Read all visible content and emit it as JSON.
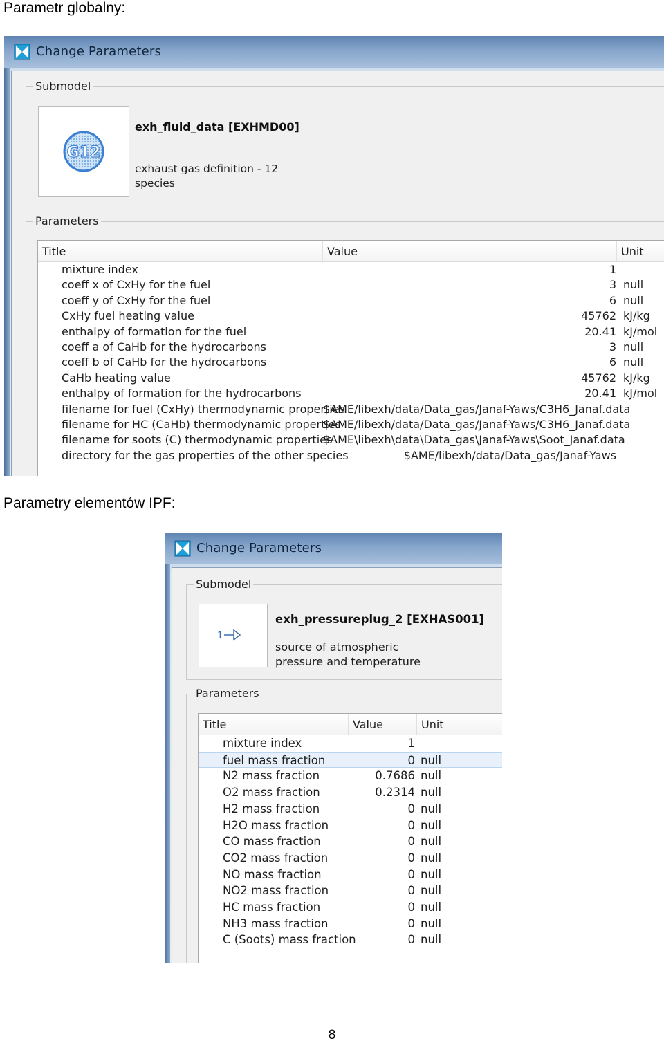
{
  "document": {
    "caption_global": "Parametr globalny:",
    "caption_ipf": "Parametry elementów IPF:",
    "page_number": "8"
  },
  "dialog_global": {
    "title": "Change Parameters",
    "submodel_label": "Submodel",
    "submodel_icon": "G12-globe-icon",
    "submodel_icon_text": "G12",
    "submodel_name": "exh_fluid_data [EXHMD00]",
    "submodel_desc_1": "exhaust gas definition - 12",
    "submodel_desc_2": "species",
    "parameters_label": "Parameters",
    "columns": {
      "title": "Title",
      "value": "Value",
      "unit": "Unit"
    },
    "rows": [
      {
        "title": "mixture index",
        "value": "1",
        "unit": ""
      },
      {
        "title": "coeff x of CxHy for the fuel",
        "value": "3",
        "unit": "null"
      },
      {
        "title": "coeff y of CxHy for the fuel",
        "value": "6",
        "unit": "null"
      },
      {
        "title": "CxHy fuel heating value",
        "value": "45762",
        "unit": "kJ/kg"
      },
      {
        "title": "enthalpy of formation for the fuel",
        "value": "20.41",
        "unit": "kJ/mol"
      },
      {
        "title": "coeff a of CaHb for the hydrocarbons",
        "value": "3",
        "unit": "null"
      },
      {
        "title": "coeff b of CaHb for the hydrocarbons",
        "value": "6",
        "unit": "null"
      },
      {
        "title": "CaHb heating value",
        "value": "45762",
        "unit": "kJ/kg"
      },
      {
        "title": "enthalpy of formation for the hydrocarbons",
        "value": "20.41",
        "unit": "kJ/mol"
      },
      {
        "title": "filename for fuel (CxHy) thermodynamic properties",
        "value": "$AME/libexh/data/Data_gas/Janaf-Yaws/C3H6_Janaf.data",
        "unit": ""
      },
      {
        "title": "filename for HC (CaHb) thermodynamic properties",
        "value": "$AME/libexh/data/Data_gas/Janaf-Yaws/C3H6_Janaf.data",
        "unit": ""
      },
      {
        "title": "filename for soots (C) thermodynamic properties",
        "value": "$AME\\libexh\\data\\Data_gas\\Janaf-Yaws\\Soot_Janaf.data",
        "unit": ""
      },
      {
        "title": "directory for the gas properties of the other species",
        "value": "$AME/libexh/data/Data_gas/Janaf-Yaws",
        "unit": ""
      }
    ]
  },
  "dialog_ipf": {
    "title": "Change Parameters",
    "submodel_label": "Submodel",
    "submodel_icon": "port-arrow-icon",
    "submodel_icon_text": "1",
    "submodel_name": "exh_pressureplug_2 [EXHAS001]",
    "submodel_desc_1": "source of atmospheric",
    "submodel_desc_2": "pressure and temperature",
    "parameters_label": "Parameters",
    "columns": {
      "title": "Title",
      "value": "Value",
      "unit": "Unit"
    },
    "selected_row": 1,
    "rows": [
      {
        "title": "mixture index",
        "value": "1",
        "unit": ""
      },
      {
        "title": "fuel mass fraction",
        "value": "0",
        "unit": "null"
      },
      {
        "title": "N2 mass fraction",
        "value": "0.7686",
        "unit": "null"
      },
      {
        "title": "O2 mass fraction",
        "value": "0.2314",
        "unit": "null"
      },
      {
        "title": "H2 mass fraction",
        "value": "0",
        "unit": "null"
      },
      {
        "title": "H2O mass fraction",
        "value": "0",
        "unit": "null"
      },
      {
        "title": "CO mass fraction",
        "value": "0",
        "unit": "null"
      },
      {
        "title": "CO2 mass fraction",
        "value": "0",
        "unit": "null"
      },
      {
        "title": "NO mass fraction",
        "value": "0",
        "unit": "null"
      },
      {
        "title": "NO2 mass fraction",
        "value": "0",
        "unit": "null"
      },
      {
        "title": "HC mass fraction",
        "value": "0",
        "unit": "null"
      },
      {
        "title": "NH3 mass fraction",
        "value": "0",
        "unit": "null"
      },
      {
        "title": "C (Soots) mass fraction",
        "value": "0",
        "unit": "null"
      }
    ]
  },
  "colors": {
    "titlebar": "#6f93bf",
    "dialog_background": "#f0f0f0",
    "selection": "#e8f1fb",
    "icon_blue": "#3b7fd0",
    "icon_teal": "#1f9fd8"
  }
}
